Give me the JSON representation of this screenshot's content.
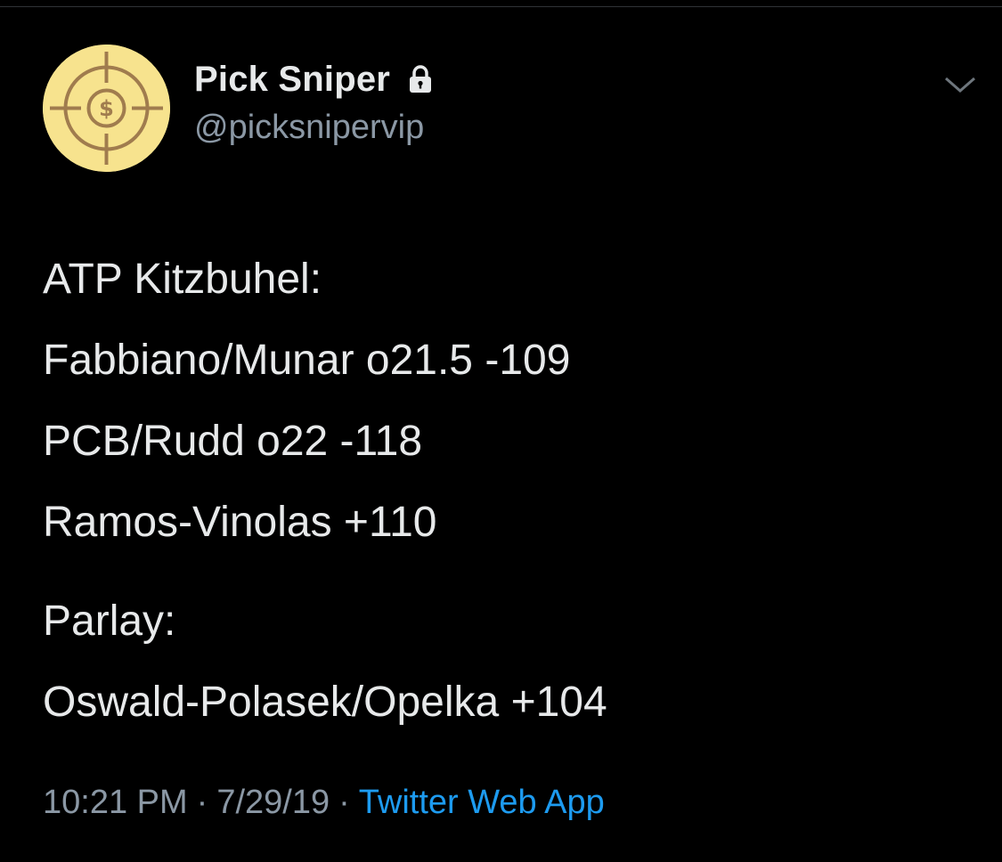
{
  "account": {
    "display_name": "Pick Sniper",
    "handle": "@picksnipervip",
    "protected_icon": "lock-icon",
    "avatar_icon": "target-dollar-icon"
  },
  "menu": {
    "icon": "chevron-down-icon"
  },
  "tweet": {
    "lines": [
      "ATP Kitzbuhel:",
      "Fabbiano/Munar o21.5 -109",
      "PCB/Rudd o22 -118",
      "Ramos-Vinolas +110"
    ],
    "lines_after_gap": [
      "Parlay:",
      "Oswald-Polasek/Opelka +104"
    ]
  },
  "meta": {
    "time": "10:21 PM",
    "separator": "·",
    "date": "7/29/19",
    "source": "Twitter Web App"
  },
  "colors": {
    "background": "#000000",
    "text": "#e7e9ea",
    "muted": "#8b98a5",
    "link": "#1d9bf0",
    "avatar_bg": "#f7e38e",
    "avatar_mark": "#a07c4e"
  }
}
